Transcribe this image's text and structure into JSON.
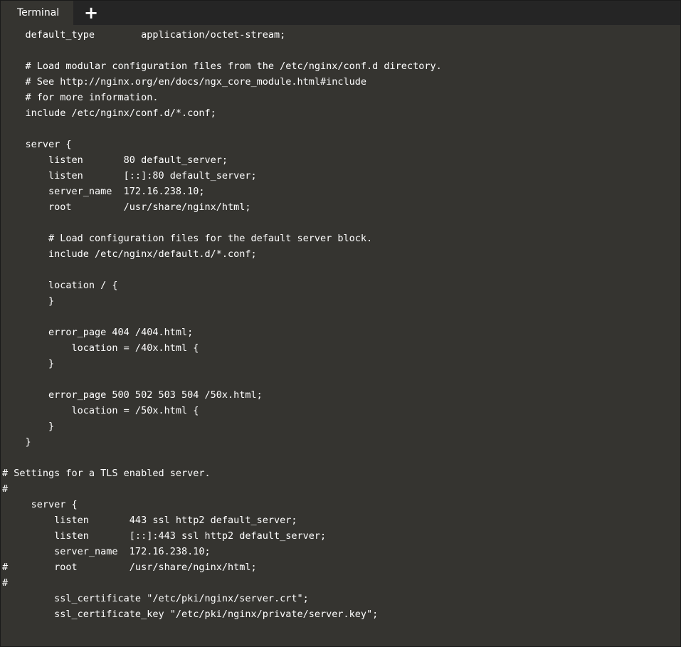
{
  "tabbar": {
    "active_tab_label": "Terminal",
    "new_tab_label": "+"
  },
  "terminal": {
    "lines": [
      "    default_type        application/octet-stream;",
      "",
      "    # Load modular configuration files from the /etc/nginx/conf.d directory.",
      "    # See http://nginx.org/en/docs/ngx_core_module.html#include",
      "    # for more information.",
      "    include /etc/nginx/conf.d/*.conf;",
      "",
      "    server {",
      "        listen       80 default_server;",
      "        listen       [::]:80 default_server;",
      "        server_name  172.16.238.10;",
      "        root         /usr/share/nginx/html;",
      "",
      "        # Load configuration files for the default server block.",
      "        include /etc/nginx/default.d/*.conf;",
      "",
      "        location / {",
      "        }",
      "",
      "        error_page 404 /404.html;",
      "            location = /40x.html {",
      "        }",
      "",
      "        error_page 500 502 503 504 /50x.html;",
      "            location = /50x.html {",
      "        }",
      "    }",
      "",
      "# Settings for a TLS enabled server.",
      "#",
      "     server {",
      "         listen       443 ssl http2 default_server;",
      "         listen       [::]:443 ssl http2 default_server;",
      "         server_name  172.16.238.10;",
      "#        root         /usr/share/nginx/html;",
      "#",
      "         ssl_certificate \"/etc/pki/nginx/server.crt\";",
      "         ssl_certificate_key \"/etc/pki/nginx/private/server.key\";"
    ]
  }
}
